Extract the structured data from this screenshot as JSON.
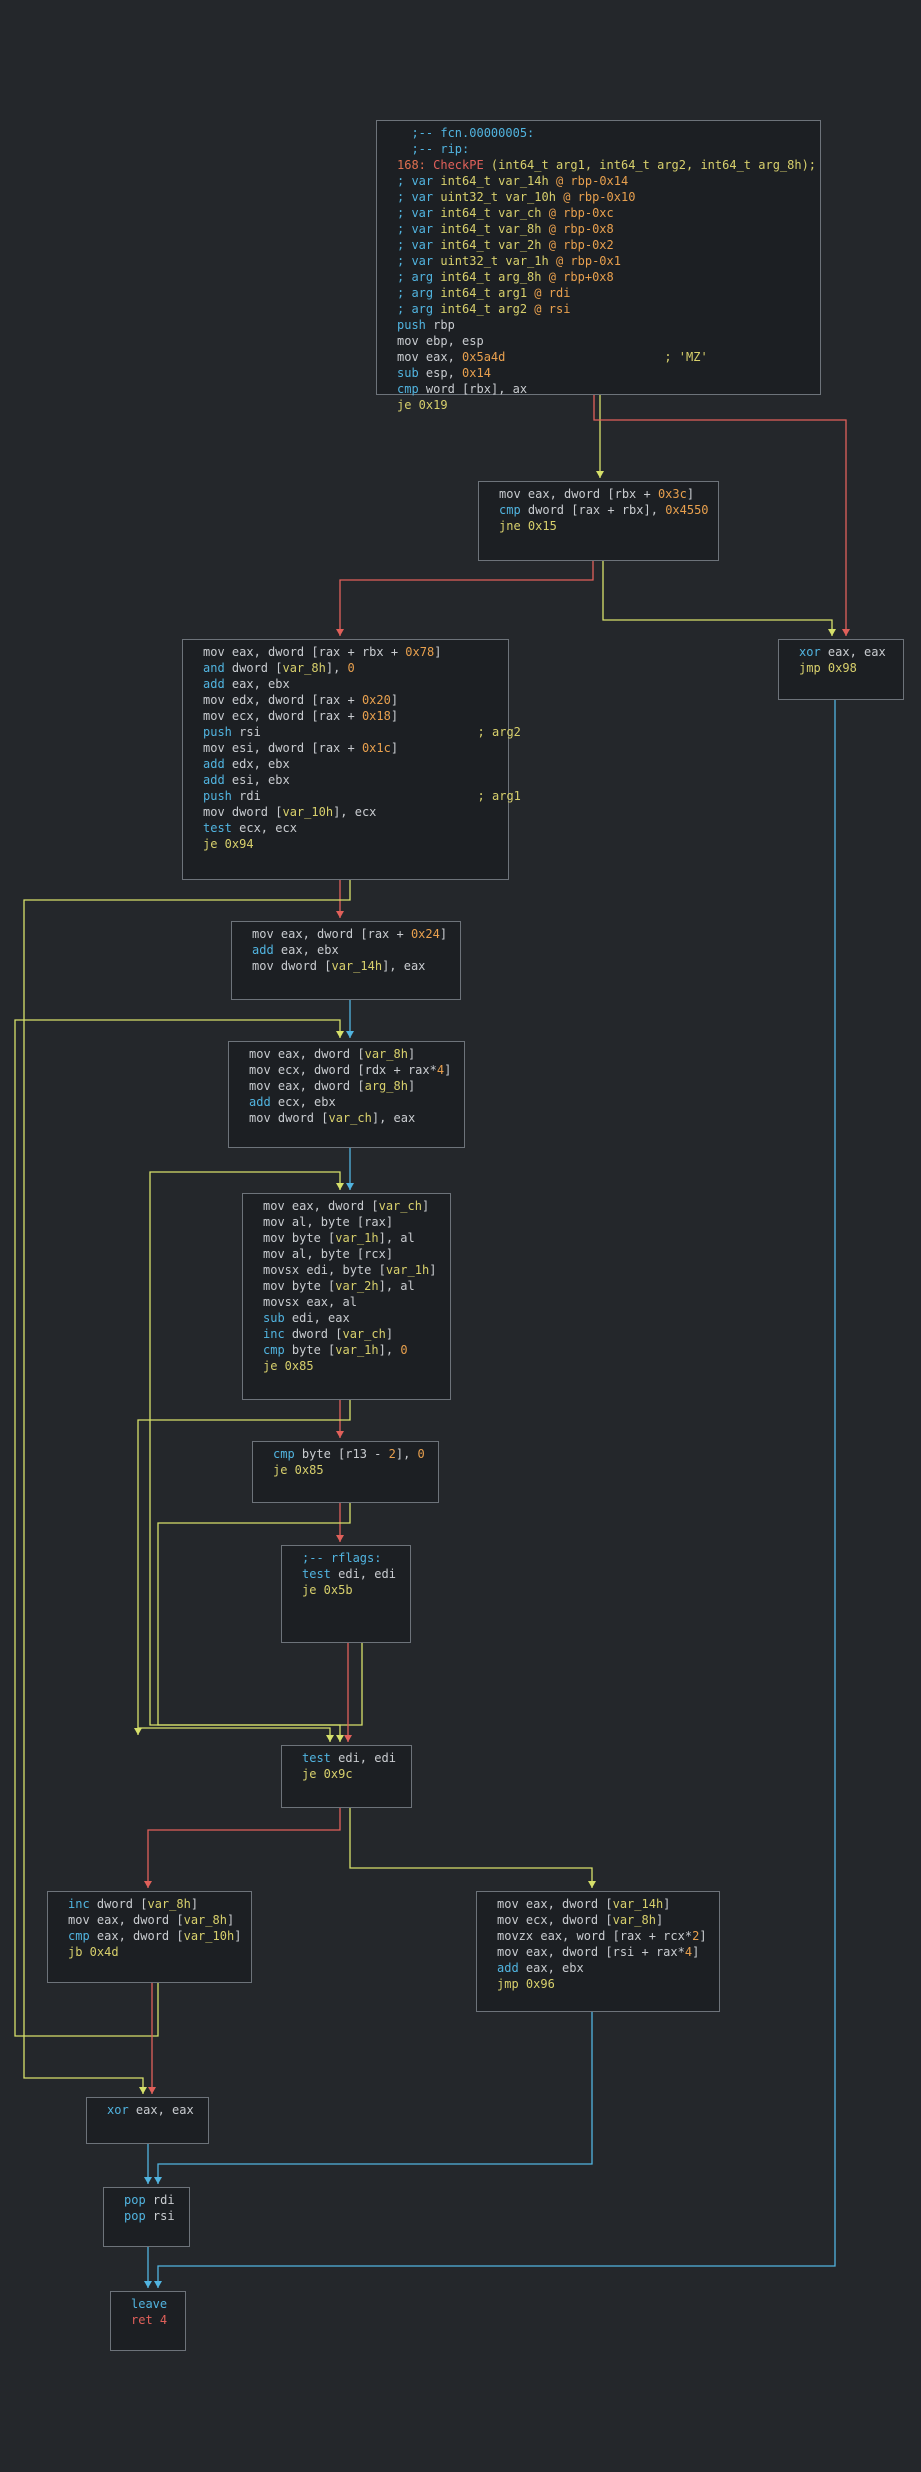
{
  "colors": {
    "background": "#24272b",
    "node_bg": "#1c1f23",
    "node_border": "#6d737a",
    "edge_true": "#d6e06a",
    "edge_false": "#e0605a",
    "edge_jump": "#51b4e0"
  },
  "nodes": [
    {
      "id": "n1",
      "lines": [
        [
          {
            "t": "  ;-- fcn.00000005:",
            "c": "cyan"
          }
        ],
        [
          {
            "t": "  ;-- rip:",
            "c": "cyan"
          }
        ],
        [
          {
            "t": "168: ",
            "c": "lab"
          },
          {
            "t": "CheckPE",
            "c": "red"
          },
          {
            "t": " (int64_t arg1, int64_t arg2, int64_t arg_8h);",
            "c": "yellow"
          }
        ],
        [
          {
            "t": "; var ",
            "c": "cyan"
          },
          {
            "t": "int64_t",
            "c": "yellow"
          },
          {
            "t": " var_14h ",
            "c": "yellow"
          },
          {
            "t": "@ rbp-0x14",
            "c": "orange"
          }
        ],
        [
          {
            "t": "; var ",
            "c": "cyan"
          },
          {
            "t": "uint32_t",
            "c": "yellow"
          },
          {
            "t": " var_10h ",
            "c": "yellow"
          },
          {
            "t": "@ rbp-0x10",
            "c": "orange"
          }
        ],
        [
          {
            "t": "; var ",
            "c": "cyan"
          },
          {
            "t": "int64_t",
            "c": "yellow"
          },
          {
            "t": " var_ch ",
            "c": "yellow"
          },
          {
            "t": "@ rbp-0xc",
            "c": "orange"
          }
        ],
        [
          {
            "t": "; var ",
            "c": "cyan"
          },
          {
            "t": "int64_t",
            "c": "yellow"
          },
          {
            "t": " var_8h ",
            "c": "yellow"
          },
          {
            "t": "@ rbp-0x8",
            "c": "orange"
          }
        ],
        [
          {
            "t": "; var ",
            "c": "cyan"
          },
          {
            "t": "int64_t",
            "c": "yellow"
          },
          {
            "t": " var_2h ",
            "c": "yellow"
          },
          {
            "t": "@ rbp-0x2",
            "c": "orange"
          }
        ],
        [
          {
            "t": "; var ",
            "c": "cyan"
          },
          {
            "t": "uint32_t",
            "c": "yellow"
          },
          {
            "t": " var_1h ",
            "c": "yellow"
          },
          {
            "t": "@ rbp-0x1",
            "c": "orange"
          }
        ],
        [
          {
            "t": "; arg ",
            "c": "cyan"
          },
          {
            "t": "int64_t",
            "c": "yellow"
          },
          {
            "t": " arg_8h ",
            "c": "yellow"
          },
          {
            "t": "@ rbp+0x8",
            "c": "orange"
          }
        ],
        [
          {
            "t": "; arg ",
            "c": "cyan"
          },
          {
            "t": "int64_t",
            "c": "yellow"
          },
          {
            "t": " arg1 ",
            "c": "yellow"
          },
          {
            "t": "@ rdi",
            "c": "orange"
          }
        ],
        [
          {
            "t": "; arg ",
            "c": "cyan"
          },
          {
            "t": "int64_t",
            "c": "yellow"
          },
          {
            "t": " arg2 ",
            "c": "yellow"
          },
          {
            "t": "@ rsi",
            "c": "orange"
          }
        ],
        [
          {
            "t": "push",
            "c": "cyan"
          },
          {
            "t": " rbp",
            "c": "plain"
          }
        ],
        [
          {
            "t": "mov ebp, esp",
            "c": "plain"
          }
        ],
        [
          {
            "t": "mov eax, ",
            "c": "plain"
          },
          {
            "t": "0x5a4d",
            "c": "orange"
          },
          {
            "t": "                      ; ",
            "c": "yellow"
          },
          {
            "t": "'MZ'",
            "c": "yellow"
          }
        ],
        [
          {
            "t": "sub",
            "c": "cyan"
          },
          {
            "t": " esp, ",
            "c": "plain"
          },
          {
            "t": "0x14",
            "c": "orange"
          }
        ],
        [
          {
            "t": "cmp",
            "c": "cyan"
          },
          {
            "t": " word ",
            "c": "plain"
          },
          {
            "t": "[",
            "c": "plain"
          },
          {
            "t": "rbx",
            "c": "plain"
          },
          {
            "t": "], ax",
            "c": "plain"
          }
        ],
        [
          {
            "t": "je 0x19",
            "c": "yellow"
          }
        ]
      ]
    },
    {
      "id": "n2",
      "lines": [
        [
          {
            "t": "mov eax, dword [rbx + ",
            "c": "plain"
          },
          {
            "t": "0x3c",
            "c": "orange"
          },
          {
            "t": "]",
            "c": "plain"
          }
        ],
        [
          {
            "t": "cmp",
            "c": "cyan"
          },
          {
            "t": " dword [rax + rbx], ",
            "c": "plain"
          },
          {
            "t": "0x4550",
            "c": "orange"
          }
        ],
        [
          {
            "t": "jne 0x15",
            "c": "yellow"
          }
        ]
      ]
    },
    {
      "id": "n3",
      "lines": [
        [
          {
            "t": "mov eax, dword [rax + rbx + ",
            "c": "plain"
          },
          {
            "t": "0x78",
            "c": "orange"
          },
          {
            "t": "]",
            "c": "plain"
          }
        ],
        [
          {
            "t": "and",
            "c": "cyan"
          },
          {
            "t": " dword [",
            "c": "plain"
          },
          {
            "t": "var_8h",
            "c": "yellow"
          },
          {
            "t": "], ",
            "c": "plain"
          },
          {
            "t": "0",
            "c": "orange"
          }
        ],
        [
          {
            "t": "add",
            "c": "cyan"
          },
          {
            "t": " eax, ebx",
            "c": "plain"
          }
        ],
        [
          {
            "t": "mov edx, dword [rax + ",
            "c": "plain"
          },
          {
            "t": "0x20",
            "c": "orange"
          },
          {
            "t": "]",
            "c": "plain"
          }
        ],
        [
          {
            "t": "mov ecx, dword [rax + ",
            "c": "plain"
          },
          {
            "t": "0x18",
            "c": "orange"
          },
          {
            "t": "]",
            "c": "plain"
          }
        ],
        [
          {
            "t": "push",
            "c": "cyan"
          },
          {
            "t": " rsi                              ",
            "c": "plain"
          },
          {
            "t": "; arg2",
            "c": "yellow"
          }
        ],
        [
          {
            "t": "mov esi, dword [rax + ",
            "c": "plain"
          },
          {
            "t": "0x1c",
            "c": "orange"
          },
          {
            "t": "]",
            "c": "plain"
          }
        ],
        [
          {
            "t": "add",
            "c": "cyan"
          },
          {
            "t": " edx, ebx",
            "c": "plain"
          }
        ],
        [
          {
            "t": "add",
            "c": "cyan"
          },
          {
            "t": " esi, ebx",
            "c": "plain"
          }
        ],
        [
          {
            "t": "push",
            "c": "cyan"
          },
          {
            "t": " rdi                              ",
            "c": "plain"
          },
          {
            "t": "; arg1",
            "c": "yellow"
          }
        ],
        [
          {
            "t": "mov dword [",
            "c": "plain"
          },
          {
            "t": "var_10h",
            "c": "yellow"
          },
          {
            "t": "], ecx",
            "c": "plain"
          }
        ],
        [
          {
            "t": "test",
            "c": "cyan"
          },
          {
            "t": " ecx, ecx",
            "c": "plain"
          }
        ],
        [
          {
            "t": "je 0x94",
            "c": "yellow"
          }
        ]
      ]
    },
    {
      "id": "n4",
      "lines": [
        [
          {
            "t": "xor",
            "c": "cyan"
          },
          {
            "t": " eax, eax",
            "c": "plain"
          }
        ],
        [
          {
            "t": "jmp 0x98",
            "c": "yellow"
          }
        ]
      ]
    },
    {
      "id": "n5",
      "lines": [
        [
          {
            "t": "mov eax, dword [rax + ",
            "c": "plain"
          },
          {
            "t": "0x24",
            "c": "orange"
          },
          {
            "t": "]",
            "c": "plain"
          }
        ],
        [
          {
            "t": "add",
            "c": "cyan"
          },
          {
            "t": " eax, ebx",
            "c": "plain"
          }
        ],
        [
          {
            "t": "mov dword [",
            "c": "plain"
          },
          {
            "t": "var_14h",
            "c": "yellow"
          },
          {
            "t": "], eax",
            "c": "plain"
          }
        ]
      ]
    },
    {
      "id": "n6",
      "lines": [
        [
          {
            "t": "mov eax, dword [",
            "c": "plain"
          },
          {
            "t": "var_8h",
            "c": "yellow"
          },
          {
            "t": "]",
            "c": "plain"
          }
        ],
        [
          {
            "t": "mov ecx, dword [rdx + rax*",
            "c": "plain"
          },
          {
            "t": "4",
            "c": "orange"
          },
          {
            "t": "]",
            "c": "plain"
          }
        ],
        [
          {
            "t": "mov eax, dword [",
            "c": "plain"
          },
          {
            "t": "arg_8h",
            "c": "yellow"
          },
          {
            "t": "]",
            "c": "plain"
          }
        ],
        [
          {
            "t": "add",
            "c": "cyan"
          },
          {
            "t": " ecx, ebx",
            "c": "plain"
          }
        ],
        [
          {
            "t": "mov dword [",
            "c": "plain"
          },
          {
            "t": "var_ch",
            "c": "yellow"
          },
          {
            "t": "], eax",
            "c": "plain"
          }
        ]
      ]
    },
    {
      "id": "n7",
      "lines": [
        [
          {
            "t": "mov eax, dword [",
            "c": "plain"
          },
          {
            "t": "var_ch",
            "c": "yellow"
          },
          {
            "t": "]",
            "c": "plain"
          }
        ],
        [
          {
            "t": "mov al, byte [rax]",
            "c": "plain"
          }
        ],
        [
          {
            "t": "mov byte [",
            "c": "plain"
          },
          {
            "t": "var_1h",
            "c": "yellow"
          },
          {
            "t": "], al",
            "c": "plain"
          }
        ],
        [
          {
            "t": "mov al, byte [rcx]",
            "c": "plain"
          }
        ],
        [
          {
            "t": "movsx edi, byte [",
            "c": "plain"
          },
          {
            "t": "var_1h",
            "c": "yellow"
          },
          {
            "t": "]",
            "c": "plain"
          }
        ],
        [
          {
            "t": "mov byte [",
            "c": "plain"
          },
          {
            "t": "var_2h",
            "c": "yellow"
          },
          {
            "t": "], al",
            "c": "plain"
          }
        ],
        [
          {
            "t": "movsx eax, al",
            "c": "plain"
          }
        ],
        [
          {
            "t": "sub",
            "c": "cyan"
          },
          {
            "t": " edi, eax",
            "c": "plain"
          }
        ],
        [
          {
            "t": "inc",
            "c": "cyan"
          },
          {
            "t": " dword [",
            "c": "plain"
          },
          {
            "t": "var_ch",
            "c": "yellow"
          },
          {
            "t": "]",
            "c": "plain"
          }
        ],
        [
          {
            "t": "cmp",
            "c": "cyan"
          },
          {
            "t": " byte [",
            "c": "plain"
          },
          {
            "t": "var_1h",
            "c": "yellow"
          },
          {
            "t": "], ",
            "c": "plain"
          },
          {
            "t": "0",
            "c": "orange"
          }
        ],
        [
          {
            "t": "je 0x85",
            "c": "yellow"
          }
        ]
      ]
    },
    {
      "id": "n8",
      "lines": [
        [
          {
            "t": "cmp",
            "c": "cyan"
          },
          {
            "t": " byte [r13 - ",
            "c": "plain"
          },
          {
            "t": "2",
            "c": "orange"
          },
          {
            "t": "], ",
            "c": "plain"
          },
          {
            "t": "0",
            "c": "orange"
          }
        ],
        [
          {
            "t": "je 0x85",
            "c": "yellow"
          }
        ]
      ]
    },
    {
      "id": "n9",
      "lines": [
        [
          {
            "t": ";-- rflags:",
            "c": "cyan"
          }
        ],
        [
          {
            "t": "test",
            "c": "cyan"
          },
          {
            "t": " edi, edi",
            "c": "plain"
          }
        ],
        [
          {
            "t": "je 0x5b",
            "c": "yellow"
          }
        ]
      ]
    },
    {
      "id": "n10",
      "lines": [
        [
          {
            "t": "test",
            "c": "cyan"
          },
          {
            "t": " edi, edi",
            "c": "plain"
          }
        ],
        [
          {
            "t": "je 0x9c",
            "c": "yellow"
          }
        ]
      ]
    },
    {
      "id": "n11",
      "lines": [
        [
          {
            "t": "inc",
            "c": "cyan"
          },
          {
            "t": " dword [",
            "c": "plain"
          },
          {
            "t": "var_8h",
            "c": "yellow"
          },
          {
            "t": "]",
            "c": "plain"
          }
        ],
        [
          {
            "t": "mov eax, dword [",
            "c": "plain"
          },
          {
            "t": "var_8h",
            "c": "yellow"
          },
          {
            "t": "]",
            "c": "plain"
          }
        ],
        [
          {
            "t": "cmp",
            "c": "cyan"
          },
          {
            "t": " eax, dword [",
            "c": "plain"
          },
          {
            "t": "var_10h",
            "c": "yellow"
          },
          {
            "t": "]",
            "c": "plain"
          }
        ],
        [
          {
            "t": "jb 0x4d",
            "c": "yellow"
          }
        ]
      ]
    },
    {
      "id": "n12",
      "lines": [
        [
          {
            "t": "mov eax, dword [",
            "c": "plain"
          },
          {
            "t": "var_14h",
            "c": "yellow"
          },
          {
            "t": "]",
            "c": "plain"
          }
        ],
        [
          {
            "t": "mov ecx, dword [",
            "c": "plain"
          },
          {
            "t": "var_8h",
            "c": "yellow"
          },
          {
            "t": "]",
            "c": "plain"
          }
        ],
        [
          {
            "t": "movzx eax, word [rax + rcx*",
            "c": "plain"
          },
          {
            "t": "2",
            "c": "orange"
          },
          {
            "t": "]",
            "c": "plain"
          }
        ],
        [
          {
            "t": "mov eax, dword [rsi + rax*",
            "c": "plain"
          },
          {
            "t": "4",
            "c": "orange"
          },
          {
            "t": "]",
            "c": "plain"
          }
        ],
        [
          {
            "t": "add",
            "c": "cyan"
          },
          {
            "t": " eax, ebx",
            "c": "plain"
          }
        ],
        [
          {
            "t": "jmp 0x96",
            "c": "yellow"
          }
        ]
      ]
    },
    {
      "id": "n13",
      "lines": [
        [
          {
            "t": "xor",
            "c": "cyan"
          },
          {
            "t": " eax, eax",
            "c": "plain"
          }
        ]
      ]
    },
    {
      "id": "n14",
      "lines": [
        [
          {
            "t": "pop",
            "c": "cyan"
          },
          {
            "t": " rdi",
            "c": "plain"
          }
        ],
        [
          {
            "t": "pop",
            "c": "cyan"
          },
          {
            "t": " rsi",
            "c": "plain"
          }
        ]
      ]
    },
    {
      "id": "n15",
      "lines": [
        [
          {
            "t": "leave",
            "c": "cyan"
          }
        ],
        [
          {
            "t": "ret 4",
            "c": "red"
          }
        ]
      ]
    }
  ]
}
